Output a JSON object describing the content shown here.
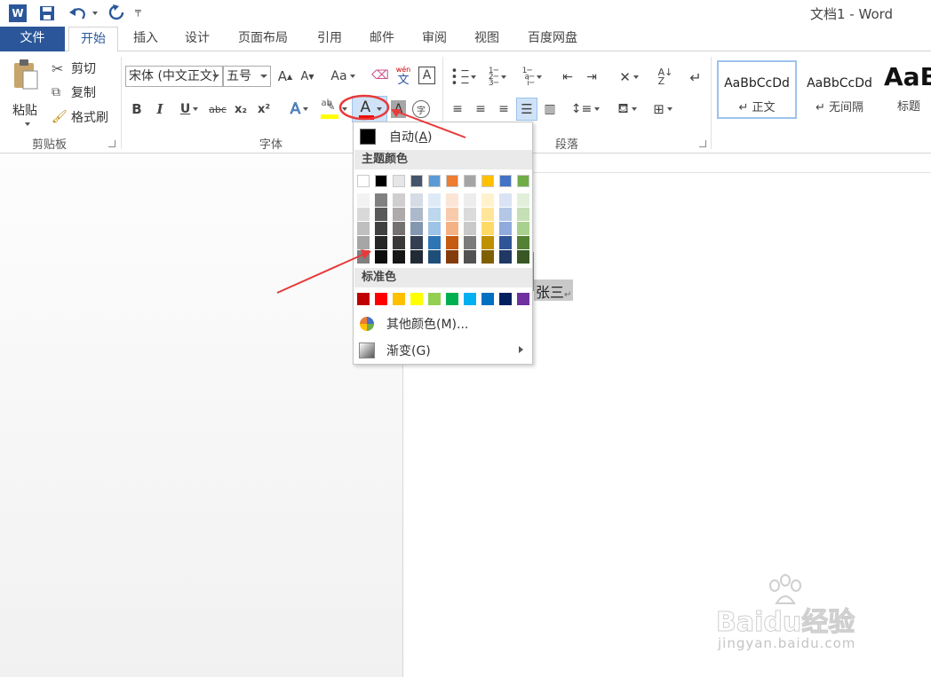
{
  "window": {
    "title": "文档1 - Word"
  },
  "qat": {
    "undo_icon": "undo-icon",
    "redo_icon": "redo-icon"
  },
  "tabs": [
    {
      "label": "文件"
    },
    {
      "label": "开始"
    },
    {
      "label": "插入"
    },
    {
      "label": "设计"
    },
    {
      "label": "页面布局"
    },
    {
      "label": "引用"
    },
    {
      "label": "邮件"
    },
    {
      "label": "审阅"
    },
    {
      "label": "视图"
    },
    {
      "label": "百度网盘"
    }
  ],
  "clipboard": {
    "paste": "粘贴",
    "cut": "剪切",
    "copy": "复制",
    "format_painter": "格式刷",
    "group": "剪贴板"
  },
  "font": {
    "name": "宋体 (中文正文)",
    "size": "五号",
    "group": "字体",
    "case_label": "Aa",
    "ruby_top": "wén",
    "ruby_bottom": "文",
    "border_char": "A",
    "bold": "B",
    "italic": "I",
    "underline": "U",
    "strike": "abc",
    "sub": "x₂",
    "sup": "x²",
    "font_color_letter": "A",
    "shading_letter": "A",
    "circle_char": "字"
  },
  "paragraph": {
    "group": "段落"
  },
  "styles": [
    {
      "sample": "AaBbCcDd",
      "name": "正文"
    },
    {
      "sample": "AaBbCcDd",
      "name": "无间隔"
    },
    {
      "sample": "AaB",
      "name": "标题"
    }
  ],
  "document": {
    "selected_text": "张三"
  },
  "color_menu": {
    "auto": "自动(A)",
    "auto_key": "A",
    "theme_header": "主题颜色",
    "theme_colors": [
      "#ffffff",
      "#000000",
      "#e7e6e6",
      "#44546a",
      "#5b9bd5",
      "#ed7d31",
      "#a5a5a5",
      "#ffc000",
      "#4472c4",
      "#70ad47"
    ],
    "theme_shades": [
      [
        "#f2f2f2",
        "#d9d9d9",
        "#bfbfbf",
        "#a6a6a6",
        "#808080"
      ],
      [
        "#808080",
        "#595959",
        "#404040",
        "#262626",
        "#0d0d0d"
      ],
      [
        "#d0cece",
        "#aeaaaa",
        "#757171",
        "#3b3838",
        "#171616"
      ],
      [
        "#d6dce5",
        "#adb9ca",
        "#8497b0",
        "#333f50",
        "#222a35"
      ],
      [
        "#deebf7",
        "#bdd7ee",
        "#9dc3e6",
        "#2e75b6",
        "#1f4e79"
      ],
      [
        "#fbe5d6",
        "#f8cbad",
        "#f4b183",
        "#c55a11",
        "#843c0c"
      ],
      [
        "#ededed",
        "#dbdbdb",
        "#c9c9c9",
        "#7b7b7b",
        "#525252"
      ],
      [
        "#fff2cc",
        "#ffe699",
        "#ffd966",
        "#bf9000",
        "#7f6000"
      ],
      [
        "#dae3f3",
        "#b4c7e7",
        "#8faadc",
        "#2f5597",
        "#1f3864"
      ],
      [
        "#e2f0d9",
        "#c5e0b4",
        "#a9d18e",
        "#548235",
        "#385723"
      ]
    ],
    "standard_header": "标准色",
    "standard_colors": [
      "#c00000",
      "#ff0000",
      "#ffc000",
      "#ffff00",
      "#92d050",
      "#00b050",
      "#00b0f0",
      "#0070c0",
      "#002060",
      "#7030a0"
    ],
    "more_colors": "其他颜色(M)...",
    "gradient": "渐变(G)"
  },
  "watermark": {
    "brand": "Baidu经验",
    "url": "jingyan.baidu.com"
  },
  "accent": "#2b579a",
  "annotation_color": "#e83a3a"
}
